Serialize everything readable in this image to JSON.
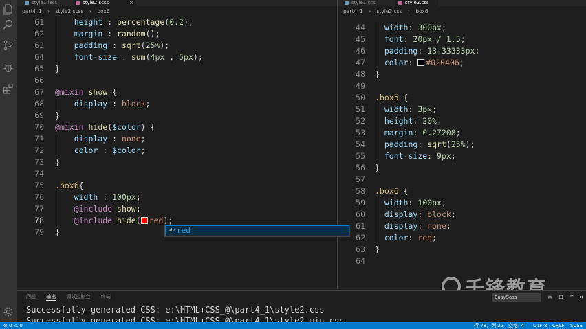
{
  "left_editor": {
    "tabs": [
      {
        "label": "style1.less",
        "active": false
      },
      {
        "label": "style2.scss",
        "active": true
      }
    ],
    "breadcrumb": [
      "part4_1",
      "style2.scss",
      "box6"
    ],
    "lines": [
      {
        "n": "61",
        "t": [
          [
            "    ",
            ""
          ],
          [
            "height",
            "prop"
          ],
          [
            " : ",
            "pun"
          ],
          [
            "percentage",
            "fn"
          ],
          [
            "(",
            "pun"
          ],
          [
            "0.2",
            "num"
          ],
          [
            ");",
            "pun"
          ]
        ]
      },
      {
        "n": "62",
        "t": [
          [
            "    ",
            ""
          ],
          [
            "margin",
            "prop"
          ],
          [
            " : ",
            "pun"
          ],
          [
            "random",
            "fn"
          ],
          [
            "();",
            "pun"
          ]
        ]
      },
      {
        "n": "63",
        "t": [
          [
            "    ",
            ""
          ],
          [
            "padding",
            "prop"
          ],
          [
            " : ",
            "pun"
          ],
          [
            "sqrt",
            "fn"
          ],
          [
            "(",
            "pun"
          ],
          [
            "25%",
            "num"
          ],
          [
            ");",
            "pun"
          ]
        ]
      },
      {
        "n": "64",
        "t": [
          [
            "    ",
            ""
          ],
          [
            "font-size",
            "prop"
          ],
          [
            " : ",
            "pun"
          ],
          [
            "sum",
            "fn"
          ],
          [
            "(",
            "pun"
          ],
          [
            "4px",
            "num"
          ],
          [
            " , ",
            "pun"
          ],
          [
            "5px",
            "num"
          ],
          [
            ");",
            "pun"
          ]
        ]
      },
      {
        "n": "65",
        "t": [
          [
            "}",
            "pun"
          ]
        ]
      },
      {
        "n": "66",
        "t": []
      },
      {
        "n": "67",
        "t": [
          [
            "@mixin",
            "at"
          ],
          [
            " ",
            ""
          ],
          [
            "show",
            "fn"
          ],
          [
            " {",
            "pun"
          ]
        ]
      },
      {
        "n": "68",
        "t": [
          [
            "    ",
            ""
          ],
          [
            "display",
            "prop"
          ],
          [
            " : ",
            "pun"
          ],
          [
            "block",
            "val"
          ],
          [
            ";",
            "pun"
          ]
        ]
      },
      {
        "n": "69",
        "t": [
          [
            "}",
            "pun"
          ]
        ]
      },
      {
        "n": "70",
        "t": [
          [
            "@mixin",
            "at"
          ],
          [
            " ",
            ""
          ],
          [
            "hide",
            "fn"
          ],
          [
            "(",
            "pun"
          ],
          [
            "$color",
            "var"
          ],
          [
            ") {",
            "pun"
          ]
        ]
      },
      {
        "n": "71",
        "t": [
          [
            "    ",
            ""
          ],
          [
            "display",
            "prop"
          ],
          [
            " : ",
            "pun"
          ],
          [
            "none",
            "val"
          ],
          [
            ";",
            "pun"
          ]
        ]
      },
      {
        "n": "72",
        "t": [
          [
            "    ",
            ""
          ],
          [
            "color",
            "prop"
          ],
          [
            " : ",
            "pun"
          ],
          [
            "$color",
            "var"
          ],
          [
            ";",
            "pun"
          ]
        ]
      },
      {
        "n": "73",
        "t": [
          [
            "}",
            "pun"
          ]
        ]
      },
      {
        "n": "74",
        "t": []
      },
      {
        "n": "75",
        "t": [
          [
            ".box6",
            "sel"
          ],
          [
            "{",
            "pun"
          ]
        ]
      },
      {
        "n": "76",
        "t": [
          [
            "    ",
            ""
          ],
          [
            "width",
            "prop"
          ],
          [
            " : ",
            "pun"
          ],
          [
            "100px",
            "num"
          ],
          [
            ";",
            "pun"
          ]
        ]
      },
      {
        "n": "77",
        "t": [
          [
            "    ",
            ""
          ],
          [
            "@include",
            "at"
          ],
          [
            " ",
            ""
          ],
          [
            "show",
            "fn"
          ],
          [
            ";",
            "pun"
          ]
        ]
      },
      {
        "n": "78",
        "t": [
          [
            "    ",
            ""
          ],
          [
            "@include",
            "at"
          ],
          [
            " ",
            ""
          ],
          [
            "hide",
            "fn"
          ],
          [
            "(",
            "pun"
          ],
          [
            "#swatch-red",
            "swatch"
          ],
          [
            "red",
            "val"
          ],
          [
            ");",
            "pun"
          ]
        ],
        "current": true
      },
      {
        "n": "79",
        "t": [
          [
            "}",
            "pun"
          ]
        ]
      }
    ],
    "suggestion": {
      "icon": "abc",
      "label": "red"
    }
  },
  "right_editor": {
    "tabs": [
      {
        "label": "style1.css",
        "active": false
      },
      {
        "label": "style2.css",
        "active": true
      }
    ],
    "breadcrumb": [
      "part4_1",
      "style2.css",
      "box6"
    ],
    "lines": [
      {
        "n": "44",
        "t": [
          [
            "  ",
            ""
          ],
          [
            "width",
            "prop"
          ],
          [
            ": ",
            "pun"
          ],
          [
            "300px",
            "num"
          ],
          [
            ";",
            "pun"
          ]
        ]
      },
      {
        "n": "45",
        "t": [
          [
            "  ",
            ""
          ],
          [
            "font",
            "prop"
          ],
          [
            ": ",
            "pun"
          ],
          [
            "20px / 1.5",
            "num"
          ],
          [
            ";",
            "pun"
          ]
        ]
      },
      {
        "n": "46",
        "t": [
          [
            "  ",
            ""
          ],
          [
            "padding",
            "prop"
          ],
          [
            ": ",
            "pun"
          ],
          [
            "13.33333px",
            "num"
          ],
          [
            ";",
            "pun"
          ]
        ]
      },
      {
        "n": "47",
        "t": [
          [
            "  ",
            ""
          ],
          [
            "color",
            "prop"
          ],
          [
            ": ",
            "pun"
          ],
          [
            "#swatch-dark",
            "swatch"
          ],
          [
            "#020406",
            "val"
          ],
          [
            ";",
            "pun"
          ]
        ]
      },
      {
        "n": "48",
        "t": [
          [
            "}",
            "pun"
          ]
        ]
      },
      {
        "n": "49",
        "t": []
      },
      {
        "n": "50",
        "t": [
          [
            ".box5",
            "sel"
          ],
          [
            " {",
            "pun"
          ]
        ]
      },
      {
        "n": "51",
        "t": [
          [
            "  ",
            ""
          ],
          [
            "width",
            "prop"
          ],
          [
            ": ",
            "pun"
          ],
          [
            "3px",
            "num"
          ],
          [
            ";",
            "pun"
          ]
        ]
      },
      {
        "n": "52",
        "t": [
          [
            "  ",
            ""
          ],
          [
            "height",
            "prop"
          ],
          [
            ": ",
            "pun"
          ],
          [
            "20%",
            "num"
          ],
          [
            ";",
            "pun"
          ]
        ]
      },
      {
        "n": "53",
        "t": [
          [
            "  ",
            ""
          ],
          [
            "margin",
            "prop"
          ],
          [
            ": ",
            "pun"
          ],
          [
            "0.27208",
            "num"
          ],
          [
            ";",
            "pun"
          ]
        ]
      },
      {
        "n": "54",
        "t": [
          [
            "  ",
            ""
          ],
          [
            "padding",
            "prop"
          ],
          [
            ": ",
            "pun"
          ],
          [
            "sqrt",
            "fn"
          ],
          [
            "(",
            "pun"
          ],
          [
            "25%",
            "num"
          ],
          [
            ");",
            "pun"
          ]
        ]
      },
      {
        "n": "55",
        "t": [
          [
            "  ",
            ""
          ],
          [
            "font-size",
            "prop"
          ],
          [
            ": ",
            "pun"
          ],
          [
            "9px",
            "num"
          ],
          [
            ";",
            "pun"
          ]
        ]
      },
      {
        "n": "56",
        "t": [
          [
            "}",
            "pun"
          ]
        ]
      },
      {
        "n": "57",
        "t": []
      },
      {
        "n": "58",
        "t": [
          [
            ".box6",
            "sel"
          ],
          [
            " {",
            "pun"
          ]
        ]
      },
      {
        "n": "59",
        "t": [
          [
            "  ",
            ""
          ],
          [
            "width",
            "prop"
          ],
          [
            ": ",
            "pun"
          ],
          [
            "100px",
            "num"
          ],
          [
            ";",
            "pun"
          ]
        ]
      },
      {
        "n": "60",
        "t": [
          [
            "  ",
            ""
          ],
          [
            "display",
            "prop"
          ],
          [
            ": ",
            "pun"
          ],
          [
            "block",
            "val"
          ],
          [
            ";",
            "pun"
          ]
        ]
      },
      {
        "n": "61",
        "t": [
          [
            "  ",
            ""
          ],
          [
            "display",
            "prop"
          ],
          [
            ": ",
            "pun"
          ],
          [
            "none",
            "val"
          ],
          [
            ";",
            "pun"
          ]
        ]
      },
      {
        "n": "62",
        "t": [
          [
            "  ",
            ""
          ],
          [
            "color",
            "prop"
          ],
          [
            ": ",
            "pun"
          ],
          [
            "red",
            "val"
          ],
          [
            ";",
            "pun"
          ]
        ]
      },
      {
        "n": "63",
        "t": [
          [
            "}",
            "pun"
          ]
        ]
      },
      {
        "n": "64",
        "t": []
      }
    ]
  },
  "panel": {
    "tabs": [
      "问题",
      "输出",
      "调试控制台",
      "终端"
    ],
    "active_tab": "输出",
    "channel": "EasySass",
    "output": [
      "Successfully generated CSS: e:\\HTML+CSS_@\\part4_1\\style2.css",
      "Successfully generated CSS: e:\\HTML+CSS_@\\part4_1\\style2.min.css"
    ]
  },
  "status": {
    "errors": "0",
    "warnings": "0",
    "position": "行 78，列 22",
    "spaces": "空格: 4",
    "encoding": "UTF-8",
    "eol": "CRLF",
    "language": "SCSS"
  },
  "watermark": "千锋教育",
  "colors": {
    "swatch-red": "#ff0000",
    "swatch-dark": "#020406",
    "accent": "#007acc"
  }
}
